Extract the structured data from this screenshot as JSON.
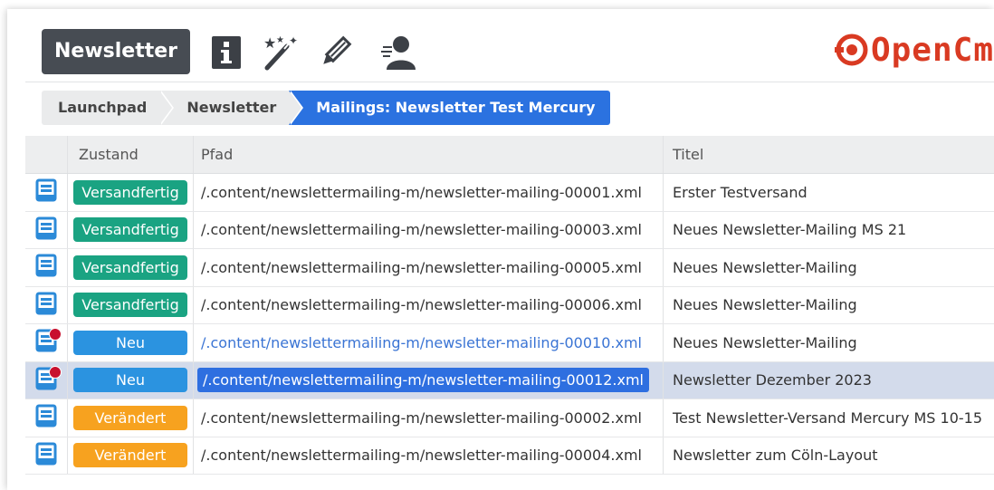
{
  "app": {
    "title": "Newsletter"
  },
  "toolbar": {
    "icons": [
      "info-icon",
      "magic-wand-icon",
      "pencil-icon",
      "user-icon"
    ]
  },
  "logo": {
    "text": "OpenCm"
  },
  "breadcrumb": [
    "Launchpad",
    "Newsletter",
    "Mailings: Newsletter Test Mercury"
  ],
  "table": {
    "columns": [
      "",
      "Zustand",
      "Pfad",
      "Titel"
    ],
    "rows": [
      {
        "state": "Versandfertig",
        "path": "/.content/newslettermailing-m/newsletter-mailing-00001.xml",
        "title": "Erster Testversand"
      },
      {
        "state": "Versandfertig",
        "path": "/.content/newslettermailing-m/newsletter-mailing-00003.xml",
        "title": "Neues Newsletter-Mailing MS 21"
      },
      {
        "state": "Versandfertig",
        "path": "/.content/newslettermailing-m/newsletter-mailing-00005.xml",
        "title": "Neues Newsletter-Mailing"
      },
      {
        "state": "Versandfertig",
        "path": "/.content/newslettermailing-m/newsletter-mailing-00006.xml",
        "title": "Neues Newsletter-Mailing"
      },
      {
        "state": "Neu",
        "path": "/.content/newslettermailing-m/newsletter-mailing-00010.xml",
        "title": "Neues Newsletter-Mailing"
      },
      {
        "state": "Neu",
        "path": "/.content/newslettermailing-m/newsletter-mailing-00012.xml",
        "title": "Newsletter Dezember 2023"
      },
      {
        "state": "Verändert",
        "path": "/.content/newslettermailing-m/newsletter-mailing-00002.xml",
        "title": "Test Newsletter-Versand Mercury MS 10-15"
      },
      {
        "state": "Verändert",
        "path": "/.content/newslettermailing-m/newsletter-mailing-00004.xml",
        "title": "Newsletter zum Cöln-Layout"
      }
    ]
  },
  "colors": {
    "Versandfertig": "#1aa382",
    "Neu": "#2b93e0",
    "Verändert": "#f7a21f",
    "accent": "#2b72e0",
    "logo": "#d93a22"
  }
}
